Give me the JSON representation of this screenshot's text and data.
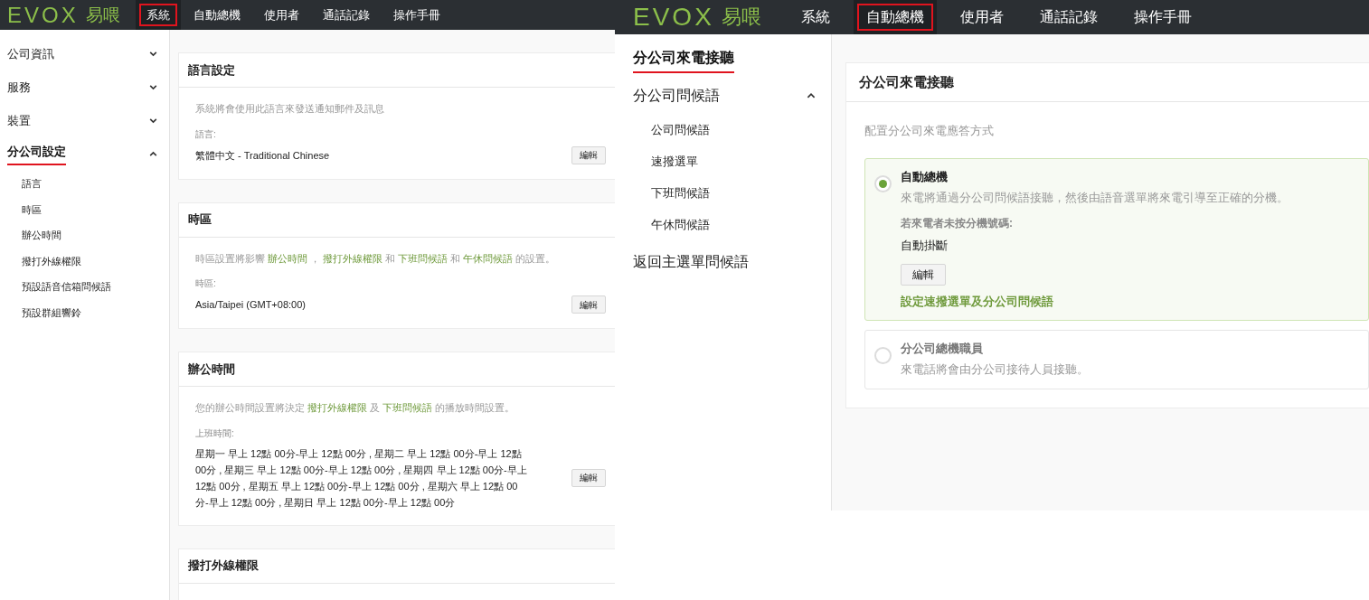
{
  "screens": [
    {
      "kind": "settings",
      "nav": {
        "logo_mark": "EVOX",
        "logo_text": "易喂",
        "items": [
          {
            "label": "系統",
            "selected": true
          },
          {
            "label": "自動總機",
            "selected": false
          },
          {
            "label": "使用者",
            "selected": false
          },
          {
            "label": "通話記錄",
            "selected": false
          },
          {
            "label": "操作手冊",
            "selected": false
          }
        ]
      },
      "sidebar": {
        "items": [
          {
            "label": "公司資訊",
            "selected": false,
            "expanded": false
          },
          {
            "label": "服務",
            "selected": false,
            "expanded": false
          },
          {
            "label": "裝置",
            "selected": false,
            "expanded": false
          },
          {
            "label": "分公司設定",
            "selected": true,
            "expanded": true,
            "children": [
              {
                "label": "語言",
                "selected": false
              },
              {
                "label": "時區",
                "selected": false
              },
              {
                "label": "辦公時間",
                "selected": false
              },
              {
                "label": "撥打外線權限",
                "selected": false
              },
              {
                "label": "預設語音信箱問候語",
                "selected": false
              },
              {
                "label": "預設群組響鈴",
                "selected": false
              }
            ]
          }
        ]
      },
      "cards": [
        {
          "title": "語言設定",
          "description": [
            {
              "kind": "plain",
              "text": "系統將會使用此語言來發送通知郵件及訊息"
            }
          ],
          "label": "語言:",
          "value": "繁體中文 - Traditional Chinese",
          "button": "編輯"
        },
        {
          "title": "時區",
          "description": [
            {
              "kind": "plain",
              "text": "時區設置將影響 "
            },
            {
              "kind": "link",
              "text": "辦公時間"
            },
            {
              "kind": "plain",
              "text": " ， "
            },
            {
              "kind": "link",
              "text": "撥打外線權限"
            },
            {
              "kind": "plain",
              "text": " 和 "
            },
            {
              "kind": "link",
              "text": "下班問候語"
            },
            {
              "kind": "plain",
              "text": " 和 "
            },
            {
              "kind": "link",
              "text": "午休問候語"
            },
            {
              "kind": "plain",
              "text": " 的設置。"
            }
          ],
          "label": "時區:",
          "value": "Asia/Taipei (GMT+08:00)",
          "button": "編輯"
        },
        {
          "title": "辦公時間",
          "description": [
            {
              "kind": "plain",
              "text": "您的辦公時間設置將決定 "
            },
            {
              "kind": "link",
              "text": "撥打外線權限"
            },
            {
              "kind": "plain",
              "text": " 及 "
            },
            {
              "kind": "link",
              "text": "下班問候語"
            },
            {
              "kind": "plain",
              "text": " 的播放時間設置。"
            }
          ],
          "label": "上班時間:",
          "value": "星期一 早上 12點 00分-早上 12點 00分 , 星期二 早上 12點 00分-早上 12點 00分 , 星期三 早上 12點 00分-早上 12點 00分 , 星期四 早上 12點 00分-早上 12點 00分 , 星期五 早上 12點 00分-早上 12點 00分 , 星期六 早上 12點 00分-早上 12點 00分 , 星期日 早上 12點 00分-早上 12點 00分",
          "button": "編輯"
        },
        {
          "title": "撥打外線權限"
        }
      ]
    },
    {
      "kind": "auto_attendant",
      "nav": {
        "logo_mark": "EVOX",
        "logo_text": "易喂",
        "items": [
          {
            "label": "系統",
            "selected": false
          },
          {
            "label": "自動總機",
            "selected": true
          },
          {
            "label": "使用者",
            "selected": false
          },
          {
            "label": "通話記錄",
            "selected": false
          },
          {
            "label": "操作手冊",
            "selected": false
          }
        ]
      },
      "sidebar": {
        "items": [
          {
            "label": "分公司來電接聽",
            "selected": true
          },
          {
            "label": "分公司問候語",
            "selected": false,
            "expanded": true,
            "children": [
              {
                "label": "公司問候語",
                "selected": false
              },
              {
                "label": "速撥選單",
                "selected": false
              },
              {
                "label": "下班問候語",
                "selected": false
              },
              {
                "label": "午休問候語",
                "selected": false
              }
            ]
          },
          {
            "label": "返回主選單問候語",
            "selected": false
          }
        ]
      },
      "card": {
        "title": "分公司來電接聽",
        "description": "配置分公司來電應答方式",
        "options": [
          {
            "title": "自動總機",
            "selected": true,
            "description": "來電將通過分公司問候語接聽，然後由語音選單將來電引導至正確的分機。",
            "label": "若來電者未按分機號碼:",
            "value": "自動掛斷",
            "button": "編輯",
            "link": "設定速撥選單及分公司問候語"
          },
          {
            "title": "分公司總機職員",
            "selected": false,
            "description": "來電話將會由分公司接待人員接聽。"
          }
        ]
      }
    }
  ]
}
